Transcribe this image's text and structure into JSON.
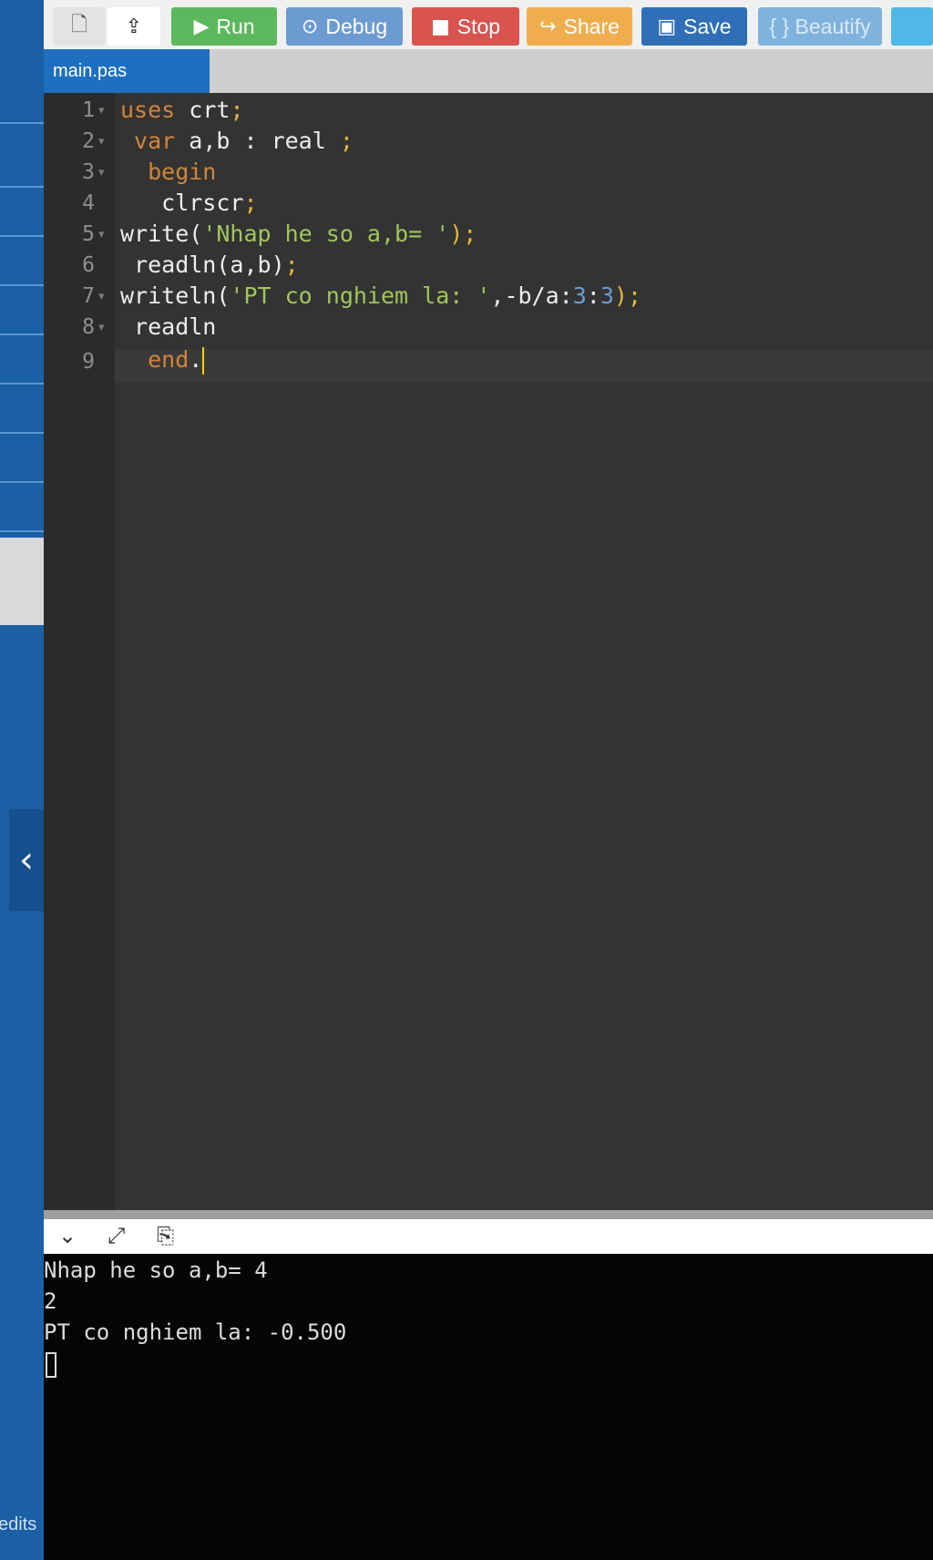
{
  "toolbar": {
    "new_icon": "file-icon",
    "upload_icon": "upload-icon",
    "buttons": [
      {
        "label": "Run",
        "icon": "▶",
        "color": "#5cb85c"
      },
      {
        "label": "Debug",
        "icon": "⊙",
        "color": "#6c9bd2"
      },
      {
        "label": "Stop",
        "icon": "■",
        "color": "#d9534f"
      },
      {
        "label": "Share",
        "icon": "↪",
        "color": "#f0ad4e"
      },
      {
        "label": "Save",
        "icon": "💾",
        "color": "#2e6fb8"
      },
      {
        "label": "{ } Beautify",
        "icon": "",
        "color": "#7fb3de"
      }
    ]
  },
  "tab": {
    "label": "main.pas"
  },
  "editor": {
    "line_numbers": [
      "1",
      "2",
      "3",
      "4",
      "5",
      "6",
      "7",
      "8",
      "9"
    ],
    "lines": [
      {
        "t1": "uses",
        "t2": " crt",
        "t3": ";"
      },
      {
        "t1": " var",
        "t2": " a,b : real ",
        "t3": ";"
      },
      {
        "t1": "  begin"
      },
      {
        "t2": "   clrscr",
        "t3": ";"
      },
      {
        "t2": "write(",
        "s": "'Nhap he so a,b= '",
        "t4": ");"
      },
      {
        "t2": " readln(a,b)",
        "t3": ";"
      },
      {
        "t2": "writeln(",
        "s": "'PT co nghiem la: '",
        "t5": ",-b/a:",
        "n1": "3",
        ":": ":",
        "n2": "3",
        "t6": ");"
      },
      {
        "t2": " readln"
      },
      {
        "t1": "  end",
        "t2": "."
      }
    ]
  },
  "console": {
    "lines": [
      "Nhap he so a,b= 4",
      "2",
      "PT co nghiem la: -0.500"
    ]
  },
  "sidebar": {
    "credits": "edits"
  }
}
